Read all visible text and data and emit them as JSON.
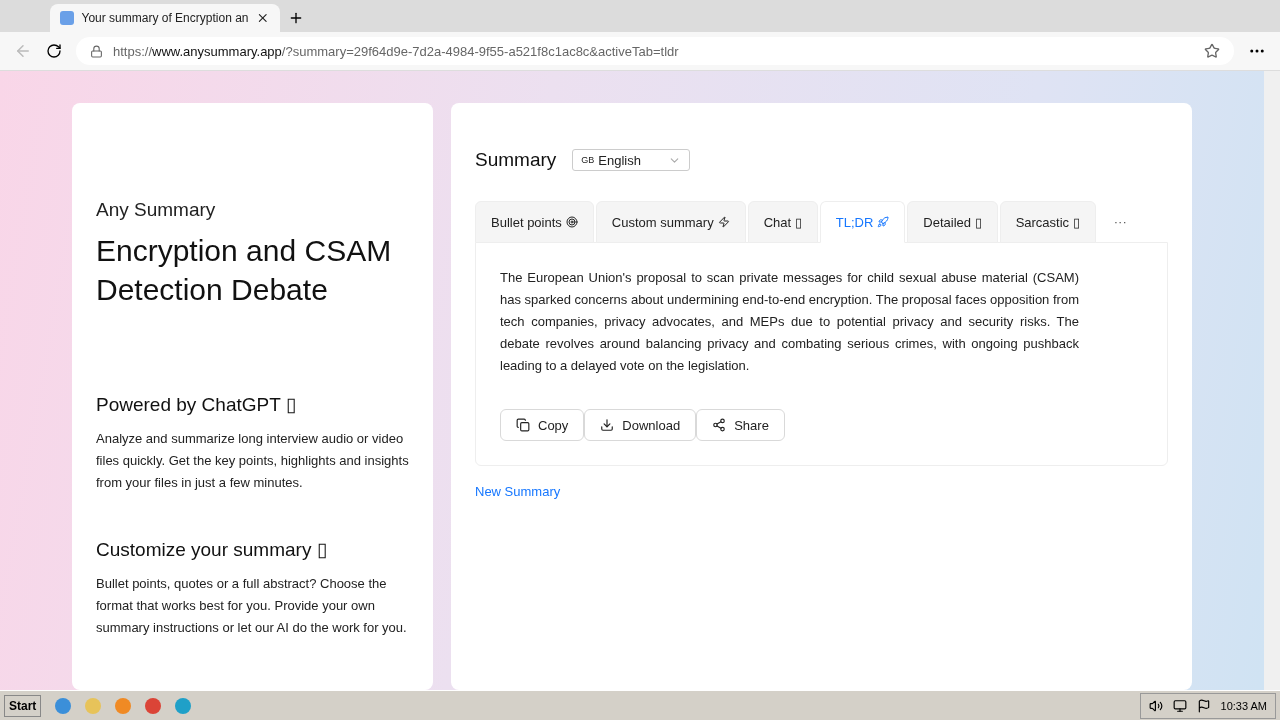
{
  "browser": {
    "tab_title": "Your summary of Encryption an",
    "url_prefix": "https://",
    "url_host": "www.anysummary.app",
    "url_rest": "/?summary=29f64d9e-7d2a-4984-9f55-a521f8c1ac8c&activeTab=tldr"
  },
  "sidebar": {
    "brand": "Any Summary",
    "title": "Encryption and CSAM Detection Debate",
    "sections": [
      {
        "heading": "Powered by ChatGPT ▯",
        "text": "Analyze and summarize long interview audio or video files quickly. Get the key points, highlights and insights from your files in just a few minutes."
      },
      {
        "heading": "Customize your summary ▯",
        "text": "Bullet points, quotes or a full abstract? Choose the format that works best for you. Provide your own summary instructions or let our AI do the work for you."
      }
    ]
  },
  "main": {
    "heading": "Summary",
    "language": {
      "flag": "GB",
      "value": "English"
    },
    "tabs": [
      {
        "label": "Bullet points",
        "kind": "target",
        "selected": false
      },
      {
        "label": "Custom summary",
        "kind": "bolt",
        "selected": false
      },
      {
        "label": "Chat ▯",
        "selected": false
      },
      {
        "label": "TL;DR",
        "kind": "rocket",
        "selected": true
      },
      {
        "label": "Detailed ▯",
        "selected": false
      },
      {
        "label": "Sarcastic ▯",
        "selected": false
      }
    ],
    "more": "···",
    "summary_text": "The European Union's proposal to scan private messages for child sexual abuse material (CSAM) has sparked concerns about undermining end-to-end encryption. The proposal faces opposition from tech companies, privacy advocates, and MEPs due to potential privacy and security risks. The debate revolves around balancing privacy and combating serious crimes, with ongoing pushback leading to a delayed vote on the legislation.",
    "actions": [
      {
        "kind": "copy",
        "label": "Copy"
      },
      {
        "kind": "download",
        "label": "Download"
      },
      {
        "kind": "share",
        "label": "Share"
      }
    ],
    "new_summary_link": "New Summary"
  },
  "taskbar": {
    "start": "Start",
    "time": "10:33 AM"
  }
}
